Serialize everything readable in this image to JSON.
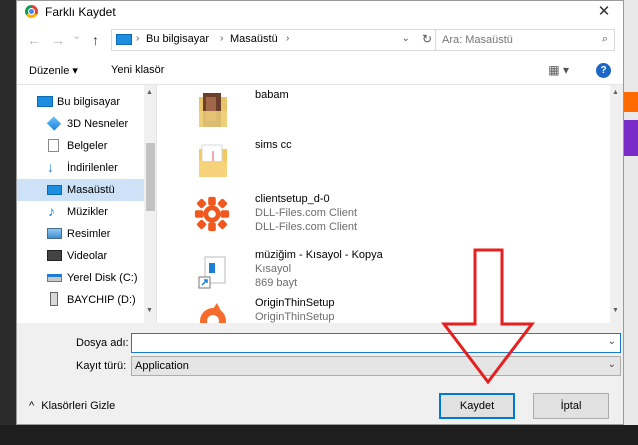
{
  "dialog": {
    "title": "Farklı Kaydet",
    "close_glyph": "✕"
  },
  "nav": {
    "back": "←",
    "forward": "→",
    "up": "↑",
    "recent": "⌄"
  },
  "address": {
    "crumbs": [
      "Bu bilgisayar",
      "Masaüstü"
    ],
    "sep": "›",
    "dropdown": "⌄",
    "refresh": "↻"
  },
  "search": {
    "placeholder": "Ara: Masaüstü",
    "icon": "⌕"
  },
  "toolbar": {
    "organize": "Düzenle ▾",
    "new_folder": "Yeni klasör",
    "view_icon": "▦ ▾",
    "help": "?"
  },
  "sidebar": {
    "items": [
      {
        "label": "Bu bilgisayar",
        "icon": "computer-icon"
      },
      {
        "label": "3D Nesneler",
        "icon": "cube-icon"
      },
      {
        "label": "Belgeler",
        "icon": "document-icon"
      },
      {
        "label": "İndirilenler",
        "icon": "download-icon"
      },
      {
        "label": "Masaüstü",
        "icon": "desktop-icon"
      },
      {
        "label": "Müzikler",
        "icon": "music-icon"
      },
      {
        "label": "Resimler",
        "icon": "pictures-icon"
      },
      {
        "label": "Videolar",
        "icon": "video-icon"
      },
      {
        "label": "Yerel Disk (C:)",
        "icon": "disk-icon"
      },
      {
        "label": "BAYCHIP (D:)",
        "icon": "usb-icon"
      }
    ]
  },
  "files": [
    {
      "name": "babam",
      "lines": [],
      "icon": "photo-folder-icon"
    },
    {
      "name": "sims cc",
      "lines": [],
      "icon": "folder-icon"
    },
    {
      "name": "clientsetup_d-0",
      "lines": [
        "DLL-Files.com Client",
        "DLL-Files.com Client"
      ],
      "icon": "dll-files-icon"
    },
    {
      "name": "müziğim - Kısayol - Kopya",
      "lines": [
        "Kısayol",
        "869 bayt"
      ],
      "icon": "shortcut-icon"
    },
    {
      "name": "OriginThinSetup",
      "lines": [
        "OriginThinSetup"
      ],
      "icon": "origin-icon"
    }
  ],
  "form": {
    "filename_label": "Dosya adı:",
    "filename_value": "",
    "type_label": "Kayıt türü:",
    "type_value": "Application",
    "chevron": "⌄"
  },
  "footer": {
    "hide_folders": "Klasörleri Gizle",
    "hide_glyph": "^",
    "save": "Kaydet",
    "cancel": "İptal"
  },
  "colors": {
    "accent": "#0078d7",
    "selection": "#cde2f6",
    "annotation_arrow": "#e52020"
  }
}
